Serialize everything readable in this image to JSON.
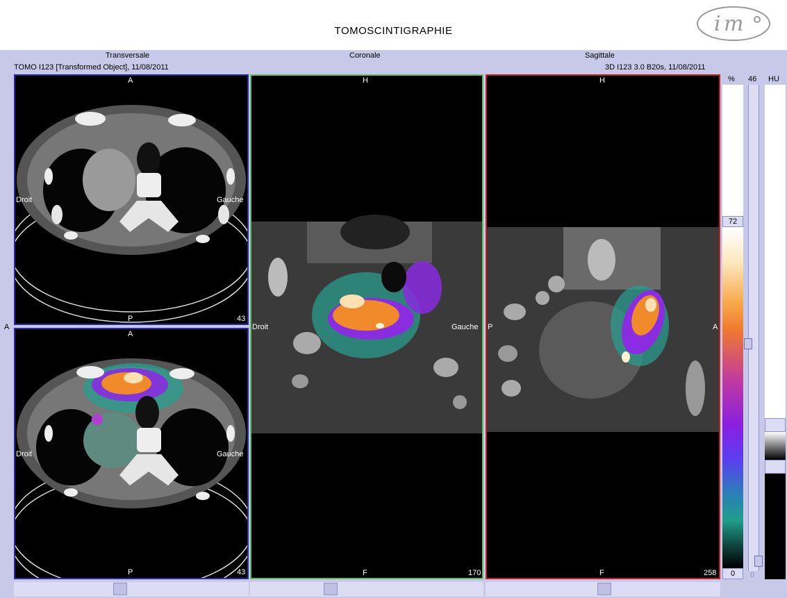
{
  "window": {
    "title": "TOMOSCINTIGRAPHIE"
  },
  "views": {
    "transversale": {
      "label": "Transversale",
      "info": "TOMO I123 [Transformed Object], 11/08/2011"
    },
    "coronale": {
      "label": "Coronale"
    },
    "sagittale": {
      "label": "Sagittale",
      "info": "3D I123  3.0  B20s, 11/08/2011"
    }
  },
  "panes": {
    "ct_axial": {
      "top": "A",
      "bottom": "P",
      "left": "Droit",
      "right": "Gauche",
      "slice": "43"
    },
    "fused_axial": {
      "top": "A",
      "bottom": "P",
      "left": "Droit",
      "right": "Gauche",
      "slice": "43"
    },
    "coronal": {
      "top": "H",
      "bottom": "F",
      "left": "Droit",
      "right": "Gauche",
      "slice": "170"
    },
    "sagittal": {
      "top": "H",
      "bottom": "F",
      "left": "P",
      "right": "A",
      "slice": "258"
    }
  },
  "side_marker": "A",
  "colorscale": {
    "unit": "%",
    "max": "72",
    "min": "0",
    "window": "46",
    "window_min": "0",
    "hu_label": "HU"
  },
  "colors": {
    "border_axial": "#2a2aa0",
    "border_coronal": "#60c060",
    "border_sagittal": "#c02020",
    "panel_bg": "#c8c8e8"
  },
  "icons": {
    "logo": "im-logo"
  }
}
